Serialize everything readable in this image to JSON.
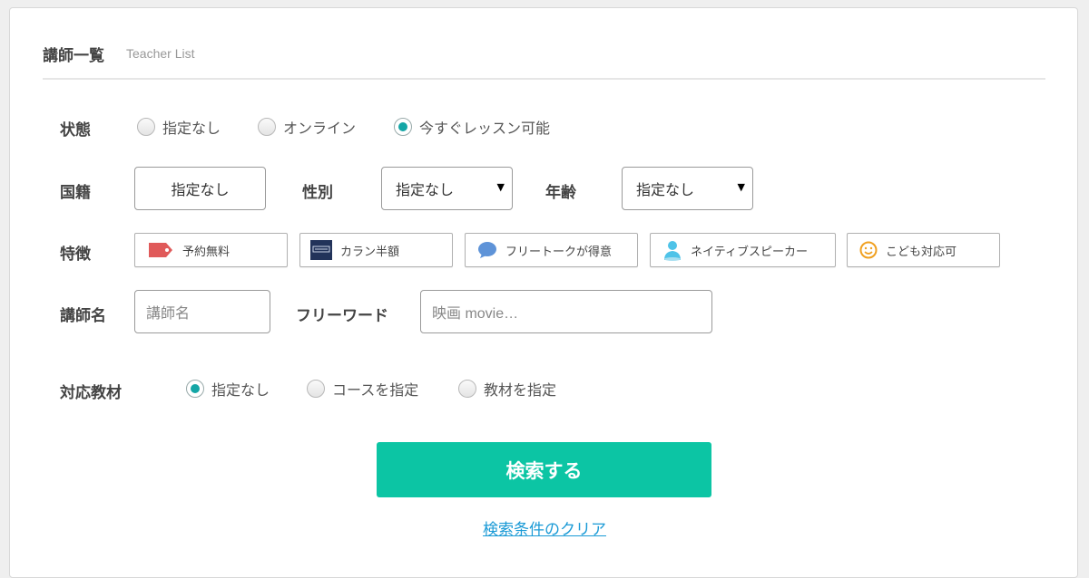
{
  "header": {
    "title": "講師一覧",
    "subtitle": "Teacher List"
  },
  "status": {
    "label": "状態",
    "options": [
      "指定なし",
      "オンライン",
      "今すぐレッスン可能"
    ],
    "selected_index": 2
  },
  "nationality": {
    "label": "国籍",
    "value": "指定なし"
  },
  "gender": {
    "label": "性別",
    "value": "指定なし"
  },
  "age": {
    "label": "年齢",
    "value": "指定なし"
  },
  "features": {
    "label": "特徴",
    "items": [
      {
        "label": "予約無料",
        "icon": "tag-icon"
      },
      {
        "label": "カラン半額",
        "icon": "callan-logo-icon"
      },
      {
        "label": "フリートークが得意",
        "icon": "speech-bubble-icon"
      },
      {
        "label": "ネイティブスピーカー",
        "icon": "person-icon"
      },
      {
        "label": "こども対応可",
        "icon": "smiley-icon"
      }
    ]
  },
  "teacher_name": {
    "label": "講師名",
    "placeholder": "講師名"
  },
  "free_word": {
    "label": "フリーワード",
    "placeholder": "映画 movie…"
  },
  "material": {
    "label": "対応教材",
    "options": [
      "指定なし",
      "コースを指定",
      "教材を指定"
    ],
    "selected_index": 0
  },
  "actions": {
    "search_label": "検索する",
    "clear_label": "検索条件のクリア"
  },
  "colors": {
    "accent": "#0cc5a4",
    "radio_checked": "#14a6a6",
    "link": "#1a9ad6",
    "tag": "#e05a5a"
  }
}
